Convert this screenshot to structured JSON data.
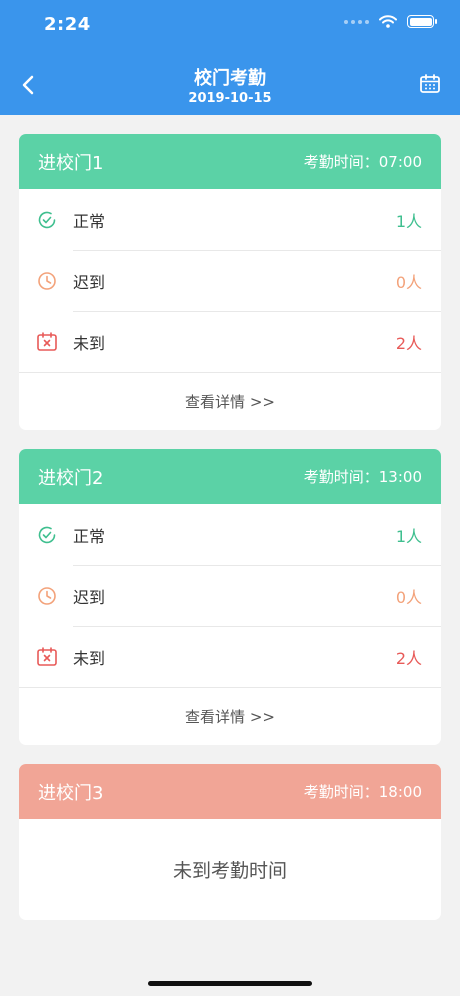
{
  "status_bar": {
    "time": "2:24"
  },
  "header": {
    "title": "校门考勤",
    "date": "2019-10-15"
  },
  "colors": {
    "topbar": "#3a95ec",
    "normal": "#3fbf8f",
    "late": "#f3a27a",
    "absent": "#e85a58",
    "head_green": "#5bd2a6",
    "head_red": "#f1a596"
  },
  "cards": [
    {
      "name": "进校门1",
      "time_label": "考勤时间：07:00",
      "rows": [
        {
          "label": "正常",
          "count": "1人"
        },
        {
          "label": "迟到",
          "count": "0人"
        },
        {
          "label": "未到",
          "count": "2人"
        }
      ],
      "detail": "查看详情 >>"
    },
    {
      "name": "进校门2",
      "time_label": "考勤时间：13:00",
      "rows": [
        {
          "label": "正常",
          "count": "1人"
        },
        {
          "label": "迟到",
          "count": "0人"
        },
        {
          "label": "未到",
          "count": "2人"
        }
      ],
      "detail": "查看详情 >>"
    },
    {
      "name": "进校门3",
      "time_label": "考勤时间：18:00",
      "message": "未到考勤时间"
    }
  ]
}
